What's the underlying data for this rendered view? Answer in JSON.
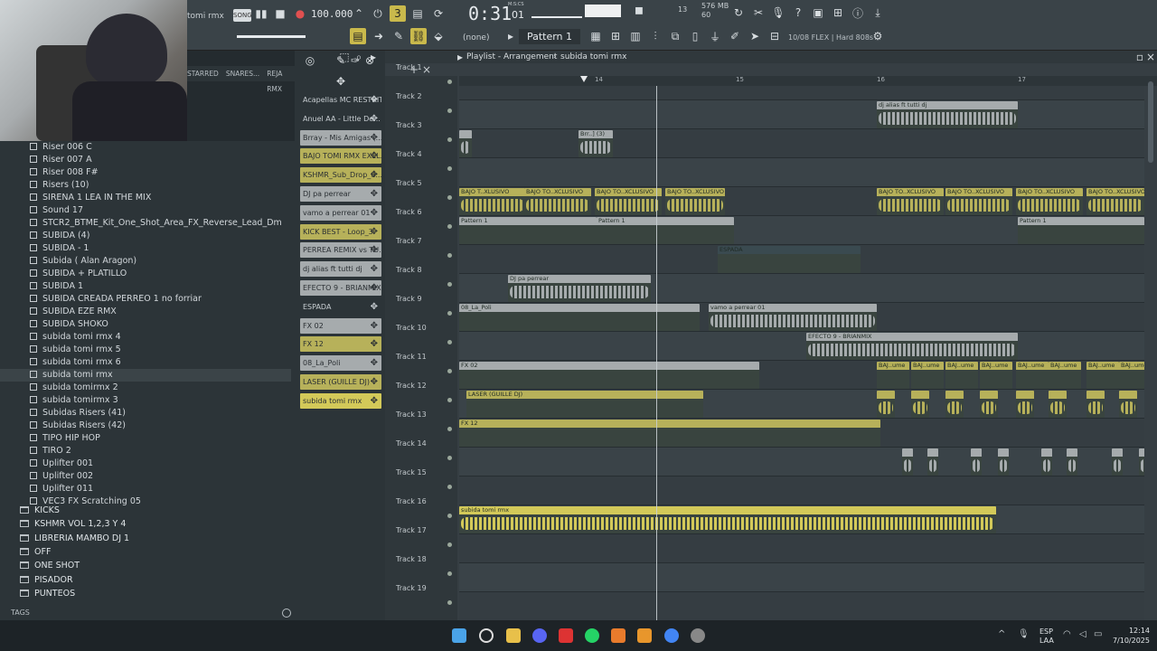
{
  "toolbar": {
    "song_title": "tomi rmx",
    "song_mode": "SONG",
    "tempo": "100.000",
    "time": "0:31",
    "time_beat": "01",
    "time_label": "M:S:CS",
    "beats_counter": "13",
    "mem": "576 MB",
    "cpu": "60",
    "pattern_selector": "(none)",
    "pattern_name": "Pattern 1",
    "flex_info": "10/08  FLEX | Hard 808s"
  },
  "browser": {
    "tabs": [
      "STARRED",
      "SNARES...",
      "REJA RMX"
    ],
    "items": [
      {
        "label": "Riser 006 C"
      },
      {
        "label": "Riser 007 A"
      },
      {
        "label": "Riser 008 F#"
      },
      {
        "label": "Risers (10)"
      },
      {
        "label": "SIRENA 1 LEA IN THE MIX"
      },
      {
        "label": "Sound 17"
      },
      {
        "label": "STCR2_BTME_Kit_One_Shot_Area_FX_Reverse_Lead_Dm"
      },
      {
        "label": "SUBIDA  (4)"
      },
      {
        "label": "SUBIDA - 1"
      },
      {
        "label": "Subida ( Alan Aragon)"
      },
      {
        "label": "SUBIDA + PLATILLO"
      },
      {
        "label": "SUBIDA 1"
      },
      {
        "label": "SUBIDA CREADA PERREO 1 no forriar"
      },
      {
        "label": "SUBIDA EZE RMX"
      },
      {
        "label": "SUBIDA SHOKO"
      },
      {
        "label": "subida tomi rmx 4"
      },
      {
        "label": "subida tomi rmx 5"
      },
      {
        "label": "subida tomi rmx 6"
      },
      {
        "label": "subida tomi rmx",
        "selected": true
      },
      {
        "label": "subida tomirmx 2"
      },
      {
        "label": "subida tomirmx 3"
      },
      {
        "label": "Subidas Risers (41)"
      },
      {
        "label": "Subidas Risers (42)"
      },
      {
        "label": "TIPO HIP HOP"
      },
      {
        "label": "TIRO 2"
      },
      {
        "label": "Uplifter 001"
      },
      {
        "label": "Uplifter 002"
      },
      {
        "label": "Uplifter 011"
      },
      {
        "label": "VEC3 FX Scratching 05"
      }
    ],
    "folders": [
      "KICKS",
      "KSHMR VOL 1,2,3 Y 4",
      "LIBRERIA MAMBO DJ 1",
      "OFF",
      "ONE SHOT",
      "PISADOR",
      "PUNTEOS"
    ],
    "tags_label": "TAGS"
  },
  "picker": {
    "items": [
      {
        "label": "Acapellas MC RESTRIT...",
        "color": "#2c3438"
      },
      {
        "label": "Anuel AA - Little De...",
        "color": "#2c3438"
      },
      {
        "label": "Brray - Mis Amigas (...",
        "color": "#a6abad"
      },
      {
        "label": "BAJO TOMI RMX EXCL...",
        "color": "#b7b15a"
      },
      {
        "label": "KSHMR_Sub_Drop_0...",
        "color": "#b7b15a"
      },
      {
        "label": "DJ pa perrear",
        "color": "#a6abad"
      },
      {
        "label": "vamo a perrear 01",
        "color": "#a6abad"
      },
      {
        "label": "KICK BEST - Loop_3",
        "color": "#b7b15a"
      },
      {
        "label": "PERREA REMIX vs TU...",
        "color": "#a6abad"
      },
      {
        "label": "dj alias ft tutti dj",
        "color": "#a6abad"
      },
      {
        "label": "EFECTO 9 - BRIANMIX",
        "color": "#a6abad"
      },
      {
        "label": "ESPADA",
        "color": "#2c3438"
      },
      {
        "label": "FX 02",
        "color": "#a6abad"
      },
      {
        "label": "FX 12",
        "color": "#b7b15a"
      },
      {
        "label": "08_La_Poli",
        "color": "#a6abad"
      },
      {
        "label": "LASER (GUILLE DJ)",
        "color": "#b7b15a"
      },
      {
        "label": "subida tomi rmx",
        "color": "#d3c959"
      }
    ]
  },
  "playlist": {
    "title": "Playlist - Arrangement",
    "arrangement": "subida tomi rmx",
    "bars": [
      "14",
      "15",
      "16",
      "17"
    ],
    "tracks": [
      "Track 1",
      "Track 2",
      "Track 3",
      "Track 4",
      "Track 5",
      "Track 6",
      "Track 7",
      "Track 8",
      "Track 9",
      "Track 10",
      "Track 11",
      "Track 12",
      "Track 13",
      "Track 14",
      "Track 15",
      "Track 16",
      "Track 17",
      "Track 18",
      "Track 19"
    ],
    "clip_labels": {
      "dj_alias": "dj alias ft tutti dj",
      "brr": "Brr..] (3)",
      "bajo1": "BAJO T..XLUSIVO",
      "bajo2": "BAJO TO..XCLUSIVO",
      "pattern1": "Pattern 1",
      "espada": "ESPADA",
      "djpa": "DJ pa perrear",
      "poli": "08_La_Poli",
      "vamo": "vamo a perrear 01",
      "efecto": "EFECTO 9 - BRIANMIX",
      "fx02": "FX 02",
      "laser": "LASER (GUILLE DJ)",
      "fx12": "FX 12",
      "baj_short": "BAJ..ume",
      "subida": "subida tomi rmx"
    }
  },
  "taskbar": {
    "lang1": "ESP",
    "lang2": "LAA",
    "time": "12:14",
    "date": "7/10/2025"
  }
}
